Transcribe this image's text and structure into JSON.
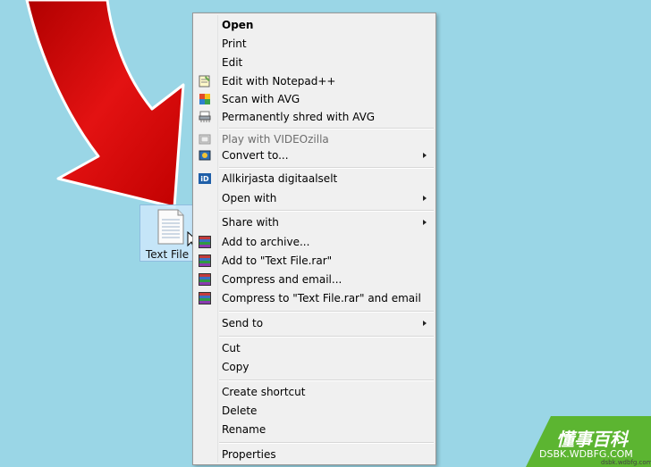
{
  "desktop": {
    "background": "#9ad6e6"
  },
  "file": {
    "label": "Text File"
  },
  "menu": {
    "items": [
      {
        "label": "Open"
      },
      {
        "label": "Print"
      },
      {
        "label": "Edit"
      },
      {
        "label": "Edit with Notepad++",
        "icon": "notepadpp-icon"
      },
      {
        "label": "Scan with AVG",
        "icon": "avg-icon"
      },
      {
        "label": "Permanently shred with AVG",
        "icon": "shred-icon"
      },
      {
        "label": "Play with VIDEOzilla",
        "icon": "videozilla-icon"
      },
      {
        "label": "Convert to...",
        "icon": "convert-icon"
      },
      {
        "label": "Allkirjasta digitaalselt",
        "icon": "id-icon"
      },
      {
        "label": "Open with"
      },
      {
        "label": "Share with"
      },
      {
        "label": "Add to archive...",
        "icon": "winrar-icon"
      },
      {
        "label": "Add to \"Text File.rar\"",
        "icon": "winrar-icon"
      },
      {
        "label": "Compress and email...",
        "icon": "winrar-icon"
      },
      {
        "label": "Compress to \"Text File.rar\" and email",
        "icon": "winrar-icon"
      },
      {
        "label": "Send to"
      },
      {
        "label": "Cut"
      },
      {
        "label": "Copy"
      },
      {
        "label": "Create shortcut"
      },
      {
        "label": "Delete"
      },
      {
        "label": "Rename"
      },
      {
        "label": "Properties"
      }
    ]
  },
  "watermark": {
    "title": "懂事百科",
    "url": "DSBK.WDBFG.COM",
    "small": "dsbk.wdbfg.com"
  },
  "colors": {
    "arrow": "#e01010",
    "menu_bg": "#f0f0f0",
    "watermark_green": "#5cb531"
  }
}
